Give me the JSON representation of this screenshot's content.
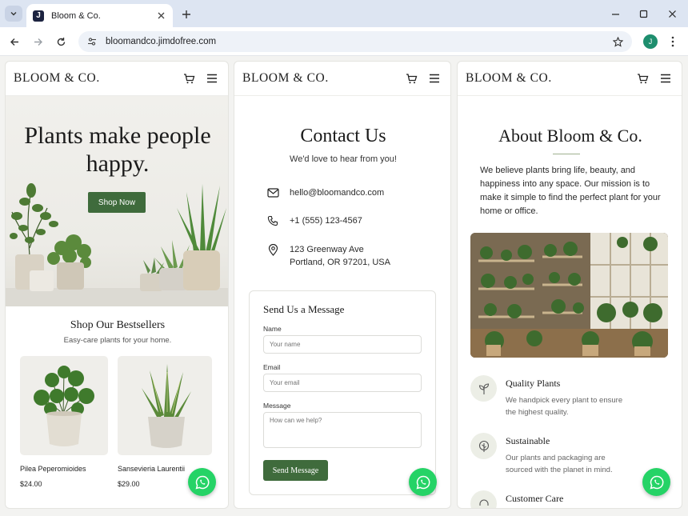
{
  "browser": {
    "tab_title": "Bloom & Co.",
    "favicon_letter": "J",
    "url": "bloomandco.jimdofree.com",
    "profile_initial": "J"
  },
  "site": {
    "brand": "BLOOM & CO."
  },
  "home": {
    "hero_title": "Plants make people happy.",
    "shop_button": "Shop Now",
    "bestsellers_title": "Shop Our Bestsellers",
    "bestsellers_subtitle": "Easy-care plants for your home.",
    "products": [
      {
        "name": "Pilea Peperomioides",
        "price": "$24.00"
      },
      {
        "name": "Sansevieria Laurentii",
        "price": "$29.00"
      }
    ]
  },
  "contact": {
    "title": "Contact Us",
    "subtitle": "We'd love to hear from you!",
    "email": "hello@bloomandco.com",
    "phone": "+1 (555) 123-4567",
    "address_line1": "123 Greenway Ave",
    "address_line2": "Portland, OR 97201, USA",
    "form": {
      "title": "Send Us a Message",
      "name_label": "Name",
      "name_placeholder": "Your name",
      "email_label": "Email",
      "email_placeholder": "Your email",
      "message_label": "Message",
      "message_placeholder": "How can we help?",
      "submit_label": "Send Message"
    }
  },
  "about": {
    "title": "About Bloom & Co.",
    "text": "We believe plants bring life, beauty, and happiness into any space. Our mission is to make it simple to find the perfect plant for your home or office.",
    "features": [
      {
        "title": "Quality Plants",
        "desc": "We handpick every plant to ensure the highest quality.",
        "icon": "sprout-icon"
      },
      {
        "title": "Sustainable",
        "desc": "Our plants and packaging are sourced with the planet in mind.",
        "icon": "leaf-icon"
      },
      {
        "title": "Customer Care",
        "desc": "",
        "icon": "headset-icon"
      }
    ]
  },
  "colors": {
    "accent_green": "#3f6b3c",
    "whatsapp_green": "#25d366"
  }
}
